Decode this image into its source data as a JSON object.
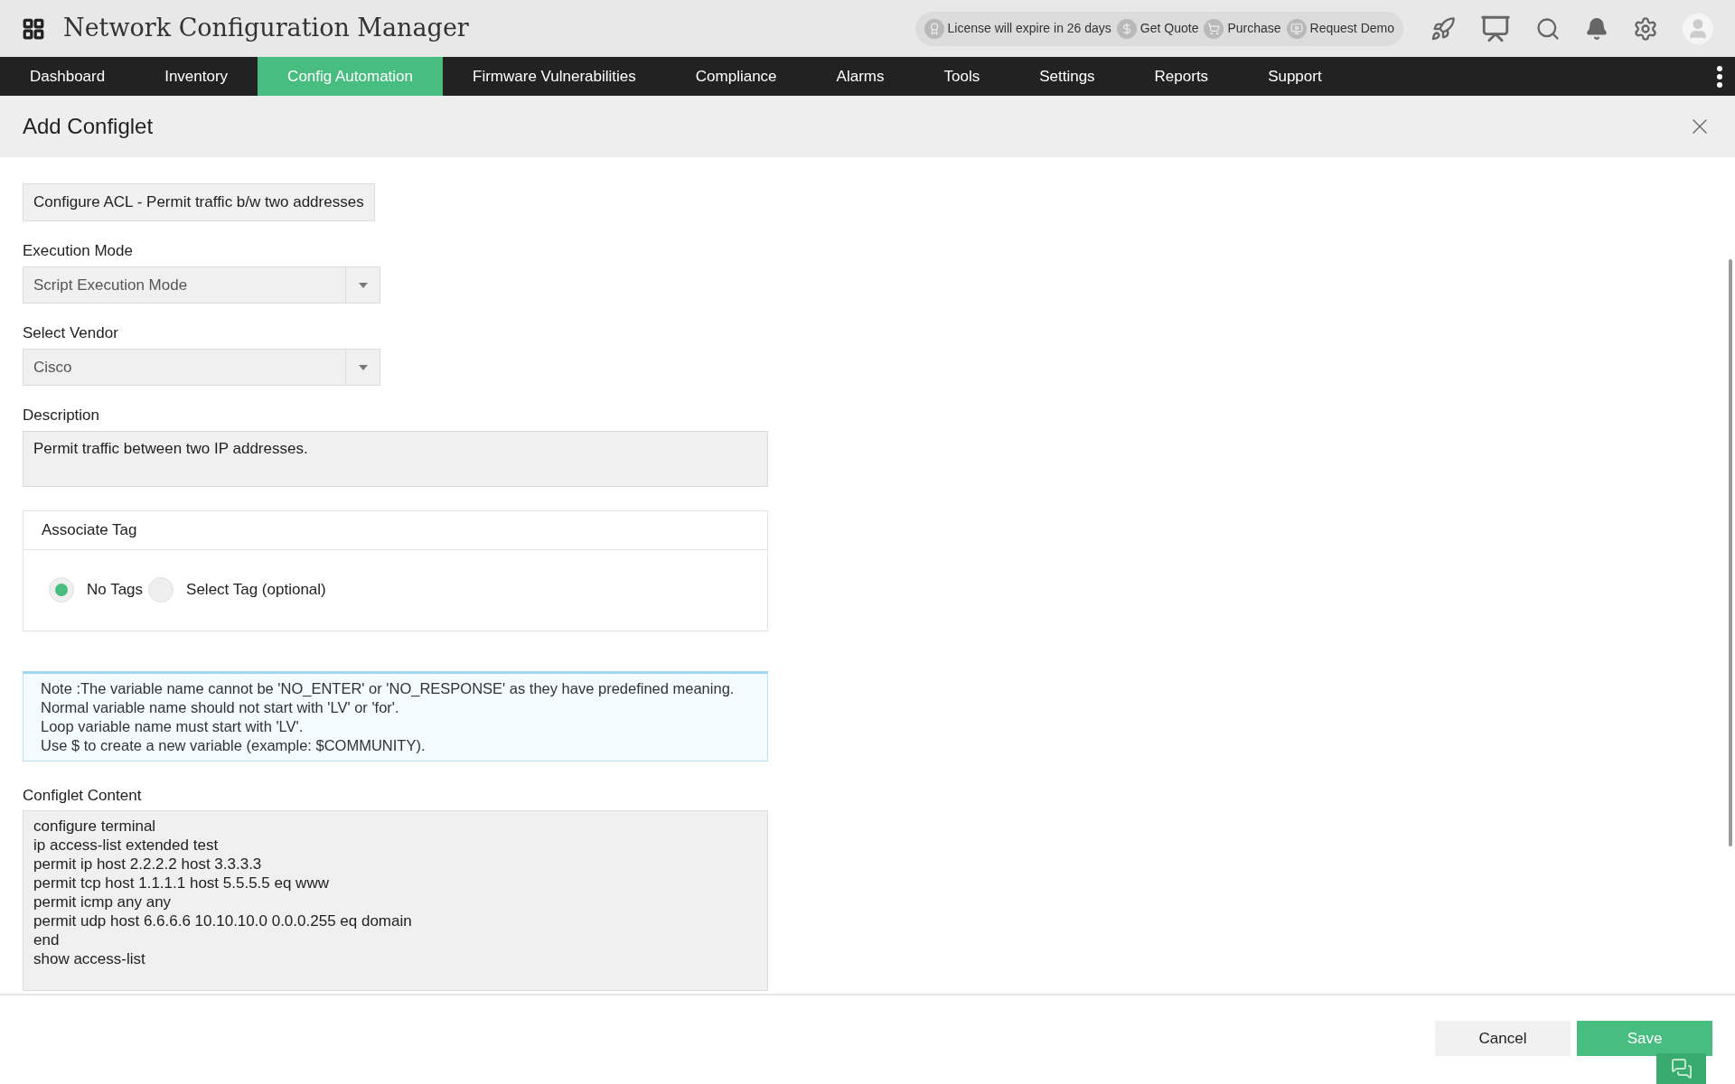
{
  "app": {
    "title": "Network Configuration Manager"
  },
  "header_links": [
    {
      "kind": "license",
      "label": "License will expire in 26 days"
    },
    {
      "kind": "quote",
      "label": "Get Quote"
    },
    {
      "kind": "purchase",
      "label": "Purchase"
    },
    {
      "kind": "demo",
      "label": "Request Demo"
    }
  ],
  "nav": [
    {
      "label": "Dashboard",
      "selected": false
    },
    {
      "label": "Inventory",
      "selected": false
    },
    {
      "label": "Config Automation",
      "selected": true
    },
    {
      "label": "Firmware Vulnerabilities",
      "selected": false
    },
    {
      "label": "Compliance",
      "selected": false
    },
    {
      "label": "Alarms",
      "selected": false
    },
    {
      "label": "Tools",
      "selected": false
    },
    {
      "label": "Settings",
      "selected": false
    },
    {
      "label": "Reports",
      "selected": false
    },
    {
      "label": "Support",
      "selected": false
    }
  ],
  "dialog": {
    "title": "Add Configlet",
    "name_value": "Configure ACL - Permit traffic b/w two addresses",
    "execution_mode": {
      "label": "Execution Mode",
      "value": "Script Execution Mode"
    },
    "vendor": {
      "label": "Select Vendor",
      "value": "Cisco"
    },
    "description": {
      "label": "Description",
      "value": "Permit traffic between two IP addresses."
    },
    "tag": {
      "title": "Associate Tag",
      "options": [
        {
          "label": "No Tags",
          "selected": true
        },
        {
          "label": "Select Tag (optional)",
          "selected": false
        }
      ]
    },
    "note": [
      "Note :The variable name cannot be 'NO_ENTER' or 'NO_RESPONSE' as they have predefined meaning.",
      "Normal variable name should not start with 'LV' or 'for'.",
      "Loop variable name must start with 'LV'.",
      "Use $ to create a new variable (example: $COMMUNITY)."
    ],
    "content": {
      "label": "Configlet Content",
      "lines": [
        "configure terminal",
        "ip access-list extended test",
        "permit ip host 2.2.2.2 host 3.3.3.3",
        "permit tcp host 1.1.1.1 host 5.5.5.5 eq www",
        "permit icmp any any",
        "permit udp host 6.6.6.6 10.10.10.0 0.0.0.255 eq domain",
        "end",
        "show access-list"
      ]
    },
    "buttons": {
      "cancel": "Cancel",
      "save": "Save"
    }
  }
}
